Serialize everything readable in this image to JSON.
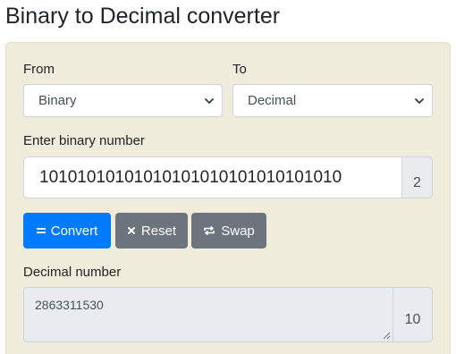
{
  "page": {
    "title": "Binary to Decimal converter"
  },
  "form": {
    "from_label": "From",
    "from_value": "Binary",
    "to_label": "To",
    "to_value": "Decimal",
    "input_label": "Enter binary number",
    "input_value": "10101010101010101010101010101010",
    "input_base": "2",
    "output_label": "Decimal number",
    "output_value": "2863311530",
    "output_base": "10"
  },
  "buttons": {
    "convert_label": "Convert",
    "reset_label": "Reset",
    "swap_label": "Swap"
  },
  "icons": {
    "convert": "equals-icon",
    "reset": "x-icon",
    "swap": "swap-arrows-icon",
    "select": "chevron-down-icon"
  },
  "colors": {
    "panel_bg": "#efecdb",
    "primary": "#007bff",
    "secondary": "#6c757d",
    "addon_bg": "#e9ecef"
  }
}
